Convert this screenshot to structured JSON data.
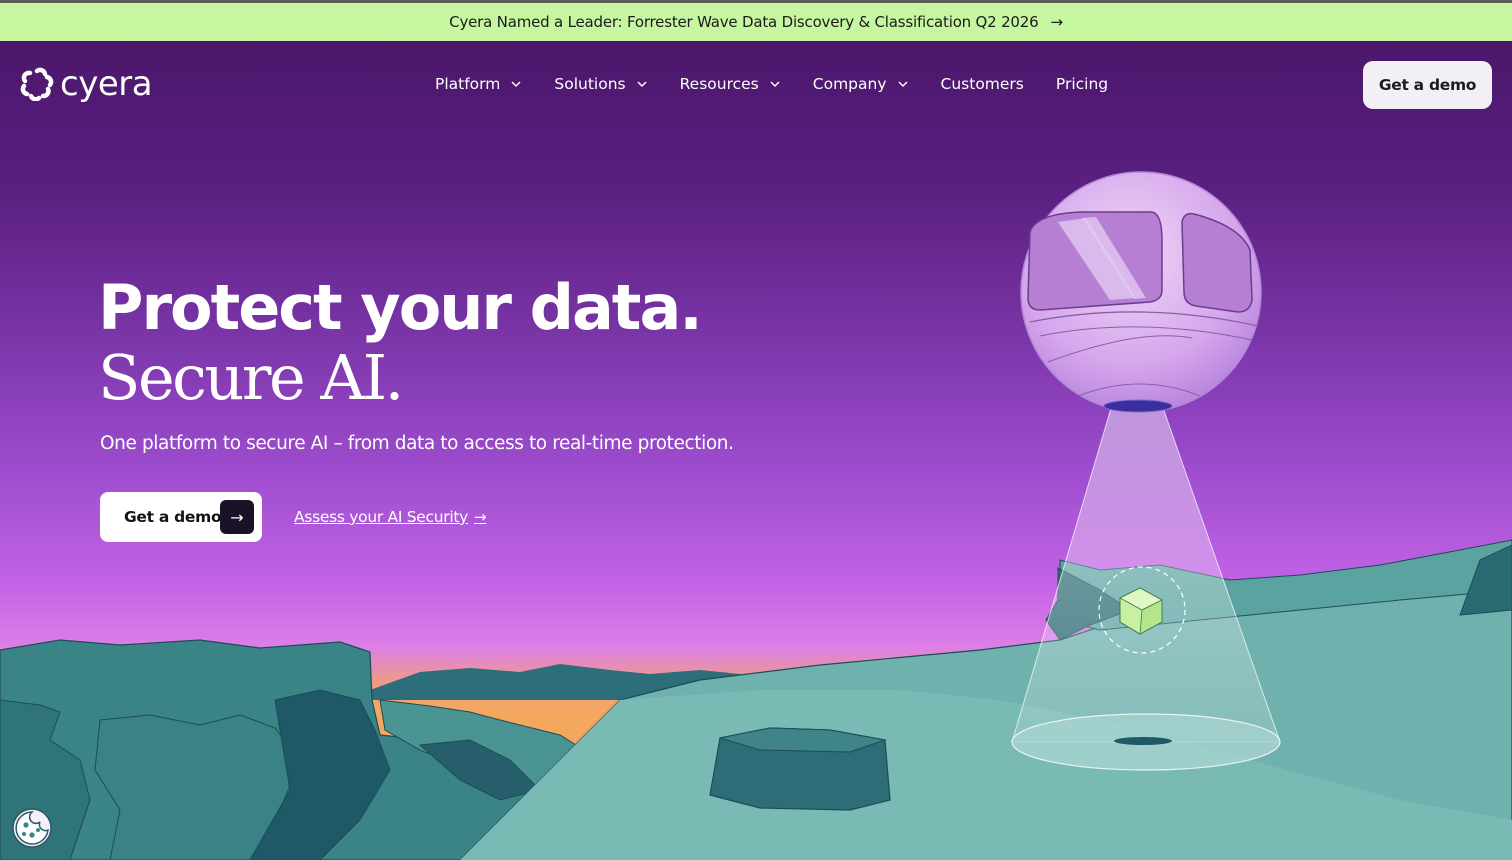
{
  "announcement": {
    "text": "Cyera Named a Leader: Forrester Wave Data Discovery & Classification Q2 2026",
    "arrow": "→"
  },
  "brand": {
    "name": "cyera",
    "logo_icon": "cyera-flower-icon"
  },
  "nav": {
    "items": [
      {
        "label": "Platform",
        "has_dropdown": true
      },
      {
        "label": "Solutions",
        "has_dropdown": true
      },
      {
        "label": "Resources",
        "has_dropdown": true
      },
      {
        "label": "Company",
        "has_dropdown": true
      },
      {
        "label": "Customers",
        "has_dropdown": false
      },
      {
        "label": "Pricing",
        "has_dropdown": false
      }
    ],
    "cta_label": "Get a demo"
  },
  "hero": {
    "headline_1": "Protect your data.",
    "headline_2": "Secure AI.",
    "subtitle": "One platform to secure AI – from data to access to real-time protection.",
    "primary_cta": "Get a demo",
    "primary_cta_arrow": "→",
    "secondary_cta": "Assess your AI Security",
    "secondary_cta_arrow": "→"
  },
  "colors": {
    "announcement_bg": "#c6f6a0",
    "sky_top": "#4b176b",
    "sky_mid": "#c262e6",
    "horizon": "#f4a85e",
    "terrain": "#3f8c8c",
    "terrain_light": "#7ab8b4",
    "cube": "#c8f0a0"
  },
  "icons": {
    "cookie": "cookie-icon",
    "chevron": "chevron-down-icon"
  }
}
